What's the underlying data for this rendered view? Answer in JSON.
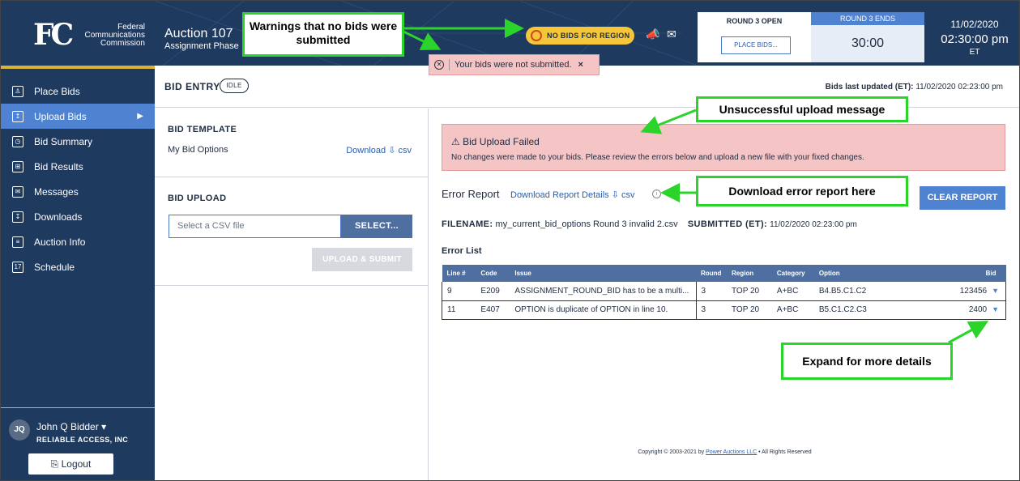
{
  "header": {
    "agency_lines": [
      "Federal",
      "Communications",
      "Commission"
    ],
    "fcc_mark": "FC",
    "auction_title": "Auction 107",
    "auction_phase": "Assignment Phase",
    "no_bids_pill": "NO BIDS FOR REGION",
    "round_open_label": "ROUND 3 OPEN",
    "place_bids_label": "PLACE BIDS...",
    "round_ends_label": "ROUND 3 ENDS",
    "timer": "30:00",
    "date": "11/02/2020",
    "time": "02:30:00 pm",
    "tz": "ET",
    "error_toast": "Your bids were not submitted.",
    "toast_close": "×",
    "bulb_icon": "lightbulb-icon",
    "megaphone_icon": "megaphone-icon",
    "mail_icon": "envelope-icon"
  },
  "sidebar": {
    "items": [
      {
        "label": "Place Bids",
        "icon": "gavel-icon",
        "glyph": "♙"
      },
      {
        "label": "Upload Bids",
        "icon": "upload-icon",
        "glyph": "↥",
        "active": true
      },
      {
        "label": "Bid Summary",
        "icon": "summary-icon",
        "glyph": "◷"
      },
      {
        "label": "Bid Results",
        "icon": "results-icon",
        "glyph": "⊞"
      },
      {
        "label": "Messages",
        "icon": "envelope-icon",
        "glyph": "✉"
      },
      {
        "label": "Downloads",
        "icon": "download-icon",
        "glyph": "↧"
      },
      {
        "label": "Auction Info",
        "icon": "clipboard-icon",
        "glyph": "≡"
      },
      {
        "label": "Schedule",
        "icon": "calendar-icon",
        "glyph": "17"
      }
    ],
    "user": {
      "initials": "JQ",
      "name": "John Q Bidder",
      "company": "RELIABLE ACCESS, INC",
      "logout": "Logout"
    }
  },
  "topbar": {
    "bid_entry": "BID ENTRY",
    "status": "IDLE",
    "last_updated_label": "Bids last updated (ET):",
    "last_updated_value": "11/02/2020 02:23:00 pm"
  },
  "left": {
    "template_title": "BID TEMPLATE",
    "template_option": "My Bid Options",
    "download_label": "Download",
    "csv_label": "csv",
    "upload_title": "BID UPLOAD",
    "file_placeholder": "Select a CSV file",
    "select_label": "SELECT...",
    "upload_submit_label": "UPLOAD & SUBMIT"
  },
  "right": {
    "fail_title": "Bid Upload Failed",
    "fail_message": "No changes were made to your bids. Please review the errors below and upload a new file with your fixed changes.",
    "error_report": "Error Report",
    "download_details": "Download Report Details",
    "csv_label": "csv",
    "clear_report": "CLEAR REPORT",
    "filename_label": "FILENAME:",
    "filename_value": "my_current_bid_options Round 3 invalid 2.csv",
    "submitted_label": "SUBMITTED (ET):",
    "submitted_value": "11/02/2020 02:23:00 pm",
    "error_list": "Error List",
    "table": {
      "headers": [
        "Line #",
        "Code",
        "Issue",
        "Round",
        "Region",
        "Category",
        "Option",
        "Bid"
      ],
      "rows": [
        [
          "9",
          "E209",
          "ASSIGNMENT_ROUND_BID has to be a multi...",
          "3",
          "TOP 20",
          "A+BC",
          "B4.B5.C1.C2",
          "123456"
        ],
        [
          "11",
          "E407",
          "OPTION is duplicate of OPTION in line 10.",
          "3",
          "TOP 20",
          "A+BC",
          "B5.C1.C2.C3",
          "2400"
        ]
      ]
    },
    "copyright_prefix": "Copyright © 2003-2021 by",
    "copyright_link": "Power Auctions LLC",
    "copyright_suffix": "• All Rights Reserved"
  },
  "annotations": {
    "warnings": "Warnings that no bids were submitted",
    "unsuccessful": "Unsuccessful upload message",
    "download_report": "Download error report here",
    "expand": "Expand for more details",
    "arrow_color": "#2ad42a"
  }
}
